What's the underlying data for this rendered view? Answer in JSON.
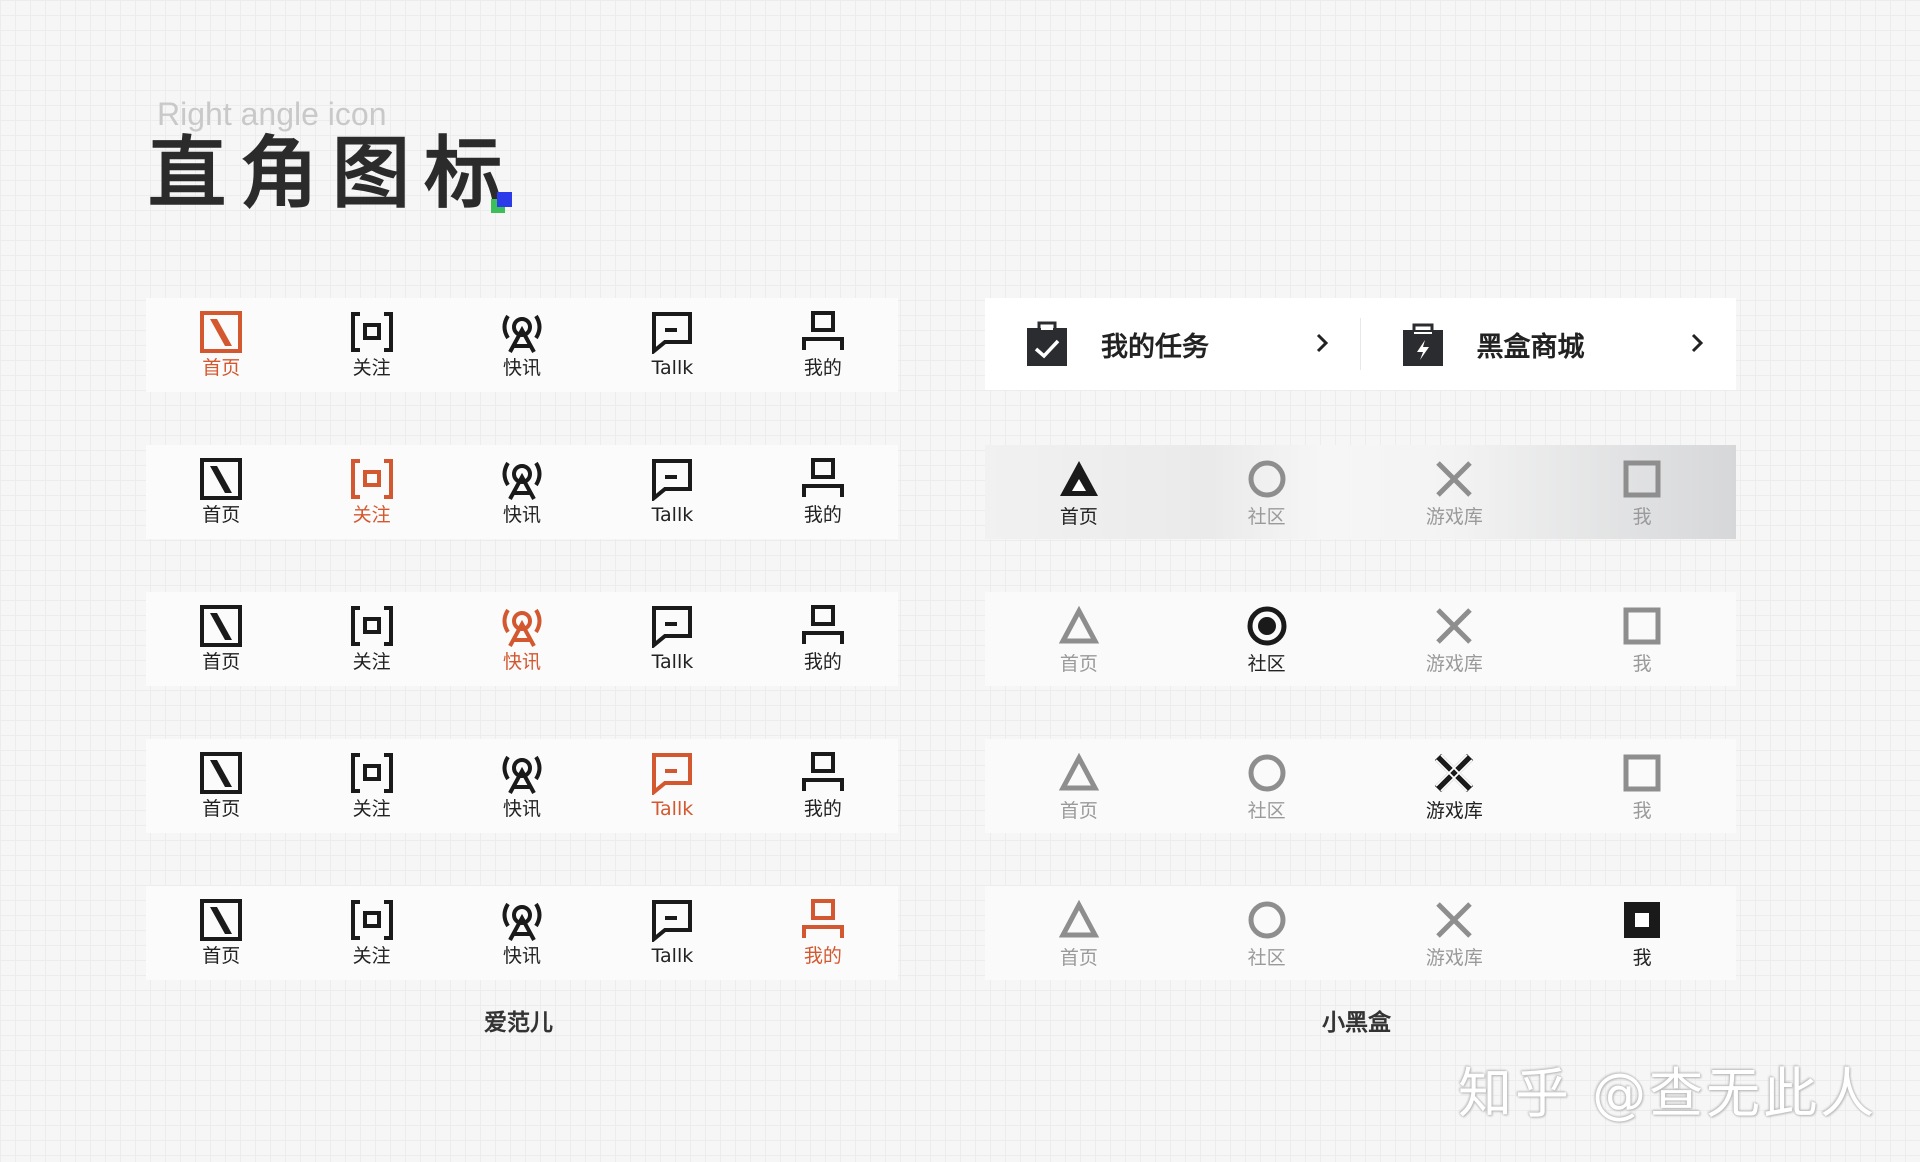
{
  "header": {
    "subtitle": "Right angle icon",
    "title": "直角图标"
  },
  "colors": {
    "accent": "#d4582f",
    "ink": "#1a1a1a",
    "muted": "#8e8e8e"
  },
  "aifaner": {
    "caption": "爱范儿",
    "tabs": [
      {
        "label": "首页",
        "icon": "home-slash-icon"
      },
      {
        "label": "关注",
        "icon": "focus-bracket-icon"
      },
      {
        "label": "快讯",
        "icon": "broadcast-icon"
      },
      {
        "label": "Tallk",
        "icon": "chat-icon"
      },
      {
        "label": "我的",
        "icon": "person-icon"
      }
    ],
    "active_per_bar": [
      0,
      1,
      2,
      3,
      4
    ]
  },
  "xiaoheihe": {
    "caption": "小黑盒",
    "cards": [
      {
        "label": "我的任务",
        "icon": "task-clipboard-icon"
      },
      {
        "label": "黑盒商城",
        "icon": "shop-bag-icon"
      }
    ],
    "tabs": [
      {
        "label": "首页",
        "icon": "triangle-icon"
      },
      {
        "label": "社区",
        "icon": "circle-icon"
      },
      {
        "label": "游戏库",
        "icon": "cross-icon"
      },
      {
        "label": "我",
        "icon": "square-icon"
      }
    ],
    "active_per_bar": [
      0,
      1,
      2,
      3
    ]
  },
  "watermark": "知乎 @查无此人"
}
